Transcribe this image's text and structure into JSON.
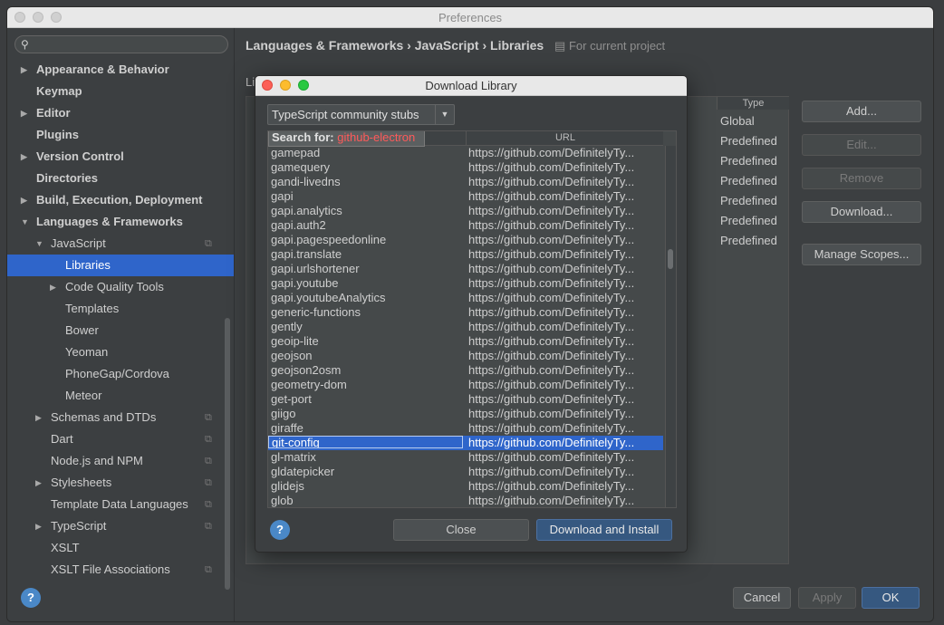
{
  "window": {
    "title": "Preferences"
  },
  "sidebar": {
    "search_placeholder": "",
    "items": [
      {
        "label": "Appearance & Behavior",
        "level": 0,
        "bold": true,
        "arrow": "right",
        "copy": false,
        "selected": false
      },
      {
        "label": "Keymap",
        "level": 0,
        "bold": true,
        "arrow": "",
        "copy": false,
        "selected": false
      },
      {
        "label": "Editor",
        "level": 0,
        "bold": true,
        "arrow": "right",
        "copy": false,
        "selected": false
      },
      {
        "label": "Plugins",
        "level": 0,
        "bold": true,
        "arrow": "",
        "copy": false,
        "selected": false
      },
      {
        "label": "Version Control",
        "level": 0,
        "bold": true,
        "arrow": "right",
        "copy": false,
        "selected": false
      },
      {
        "label": "Directories",
        "level": 0,
        "bold": true,
        "arrow": "",
        "copy": false,
        "selected": false
      },
      {
        "label": "Build, Execution, Deployment",
        "level": 0,
        "bold": true,
        "arrow": "right",
        "copy": false,
        "selected": false
      },
      {
        "label": "Languages & Frameworks",
        "level": 0,
        "bold": true,
        "arrow": "down",
        "copy": false,
        "selected": false
      },
      {
        "label": "JavaScript",
        "level": 1,
        "bold": false,
        "arrow": "down",
        "copy": true,
        "selected": false
      },
      {
        "label": "Libraries",
        "level": 2,
        "bold": false,
        "arrow": "",
        "copy": false,
        "selected": true
      },
      {
        "label": "Code Quality Tools",
        "level": 2,
        "bold": false,
        "arrow": "right",
        "copy": false,
        "selected": false
      },
      {
        "label": "Templates",
        "level": 2,
        "bold": false,
        "arrow": "",
        "copy": false,
        "selected": false
      },
      {
        "label": "Bower",
        "level": 2,
        "bold": false,
        "arrow": "",
        "copy": false,
        "selected": false
      },
      {
        "label": "Yeoman",
        "level": 2,
        "bold": false,
        "arrow": "",
        "copy": false,
        "selected": false
      },
      {
        "label": "PhoneGap/Cordova",
        "level": 2,
        "bold": false,
        "arrow": "",
        "copy": false,
        "selected": false
      },
      {
        "label": "Meteor",
        "level": 2,
        "bold": false,
        "arrow": "",
        "copy": false,
        "selected": false
      },
      {
        "label": "Schemas and DTDs",
        "level": 1,
        "bold": false,
        "arrow": "right",
        "copy": true,
        "selected": false
      },
      {
        "label": "Dart",
        "level": 1,
        "bold": false,
        "arrow": "",
        "copy": true,
        "selected": false
      },
      {
        "label": "Node.js and NPM",
        "level": 1,
        "bold": false,
        "arrow": "",
        "copy": true,
        "selected": false
      },
      {
        "label": "Stylesheets",
        "level": 1,
        "bold": false,
        "arrow": "right",
        "copy": true,
        "selected": false
      },
      {
        "label": "Template Data Languages",
        "level": 1,
        "bold": false,
        "arrow": "",
        "copy": true,
        "selected": false
      },
      {
        "label": "TypeScript",
        "level": 1,
        "bold": false,
        "arrow": "right",
        "copy": true,
        "selected": false
      },
      {
        "label": "XSLT",
        "level": 1,
        "bold": false,
        "arrow": "",
        "copy": false,
        "selected": false
      },
      {
        "label": "XSLT File Associations",
        "level": 1,
        "bold": false,
        "arrow": "",
        "copy": true,
        "selected": false
      }
    ]
  },
  "breadcrumb": {
    "part1": "Languages & Frameworks",
    "part2": "JavaScript",
    "part3": "Libraries",
    "sep": "›",
    "scope": "For current project"
  },
  "libraries": {
    "title": "Libraries",
    "type_header": "Type",
    "types": [
      "Global",
      "Predefined",
      "Predefined",
      "Predefined",
      "Predefined",
      "Predefined",
      "Predefined"
    ]
  },
  "buttons": {
    "add": "Add...",
    "edit": "Edit...",
    "remove": "Remove",
    "download": "Download...",
    "manage_scopes": "Manage Scopes...",
    "cancel": "Cancel",
    "apply": "Apply",
    "ok": "OK",
    "help": "?"
  },
  "dialog": {
    "title": "Download Library",
    "combo_value": "TypeScript community stubs",
    "search_label": "Search for:",
    "search_query": "github-electron",
    "url_header": "URL",
    "rows": [
      {
        "name": "gamepad",
        "url": "https://github.com/DefinitelyTy..."
      },
      {
        "name": "gamequery",
        "url": "https://github.com/DefinitelyTy..."
      },
      {
        "name": "gandi-livedns",
        "url": "https://github.com/DefinitelyTy..."
      },
      {
        "name": "gapi",
        "url": "https://github.com/DefinitelyTy..."
      },
      {
        "name": "gapi.analytics",
        "url": "https://github.com/DefinitelyTy..."
      },
      {
        "name": "gapi.auth2",
        "url": "https://github.com/DefinitelyTy..."
      },
      {
        "name": "gapi.pagespeedonline",
        "url": "https://github.com/DefinitelyTy..."
      },
      {
        "name": "gapi.translate",
        "url": "https://github.com/DefinitelyTy..."
      },
      {
        "name": "gapi.urlshortener",
        "url": "https://github.com/DefinitelyTy..."
      },
      {
        "name": "gapi.youtube",
        "url": "https://github.com/DefinitelyTy..."
      },
      {
        "name": "gapi.youtubeAnalytics",
        "url": "https://github.com/DefinitelyTy..."
      },
      {
        "name": "generic-functions",
        "url": "https://github.com/DefinitelyTy..."
      },
      {
        "name": "gently",
        "url": "https://github.com/DefinitelyTy..."
      },
      {
        "name": "geoip-lite",
        "url": "https://github.com/DefinitelyTy..."
      },
      {
        "name": "geojson",
        "url": "https://github.com/DefinitelyTy..."
      },
      {
        "name": "geojson2osm",
        "url": "https://github.com/DefinitelyTy..."
      },
      {
        "name": "geometry-dom",
        "url": "https://github.com/DefinitelyTy..."
      },
      {
        "name": "get-port",
        "url": "https://github.com/DefinitelyTy..."
      },
      {
        "name": "giigo",
        "url": "https://github.com/DefinitelyTy..."
      },
      {
        "name": "giraffe",
        "url": "https://github.com/DefinitelyTy..."
      },
      {
        "name": "git-config",
        "url": "https://github.com/DefinitelyTy...",
        "selected": true
      },
      {
        "name": "gl-matrix",
        "url": "https://github.com/DefinitelyTy..."
      },
      {
        "name": "gldatepicker",
        "url": "https://github.com/DefinitelyTy..."
      },
      {
        "name": "glidejs",
        "url": "https://github.com/DefinitelyTy..."
      },
      {
        "name": "glob",
        "url": "https://github.com/DefinitelyTy..."
      }
    ],
    "close_label": "Close",
    "install_label": "Download and Install"
  },
  "colors": {
    "selection": "#2f65ca",
    "help_blue": "#4a88c7",
    "close_red": "#fc5f57",
    "minimize_yellow": "#fdbc2e",
    "zoom_green": "#28c840",
    "query_red": "#ff5a5a"
  }
}
